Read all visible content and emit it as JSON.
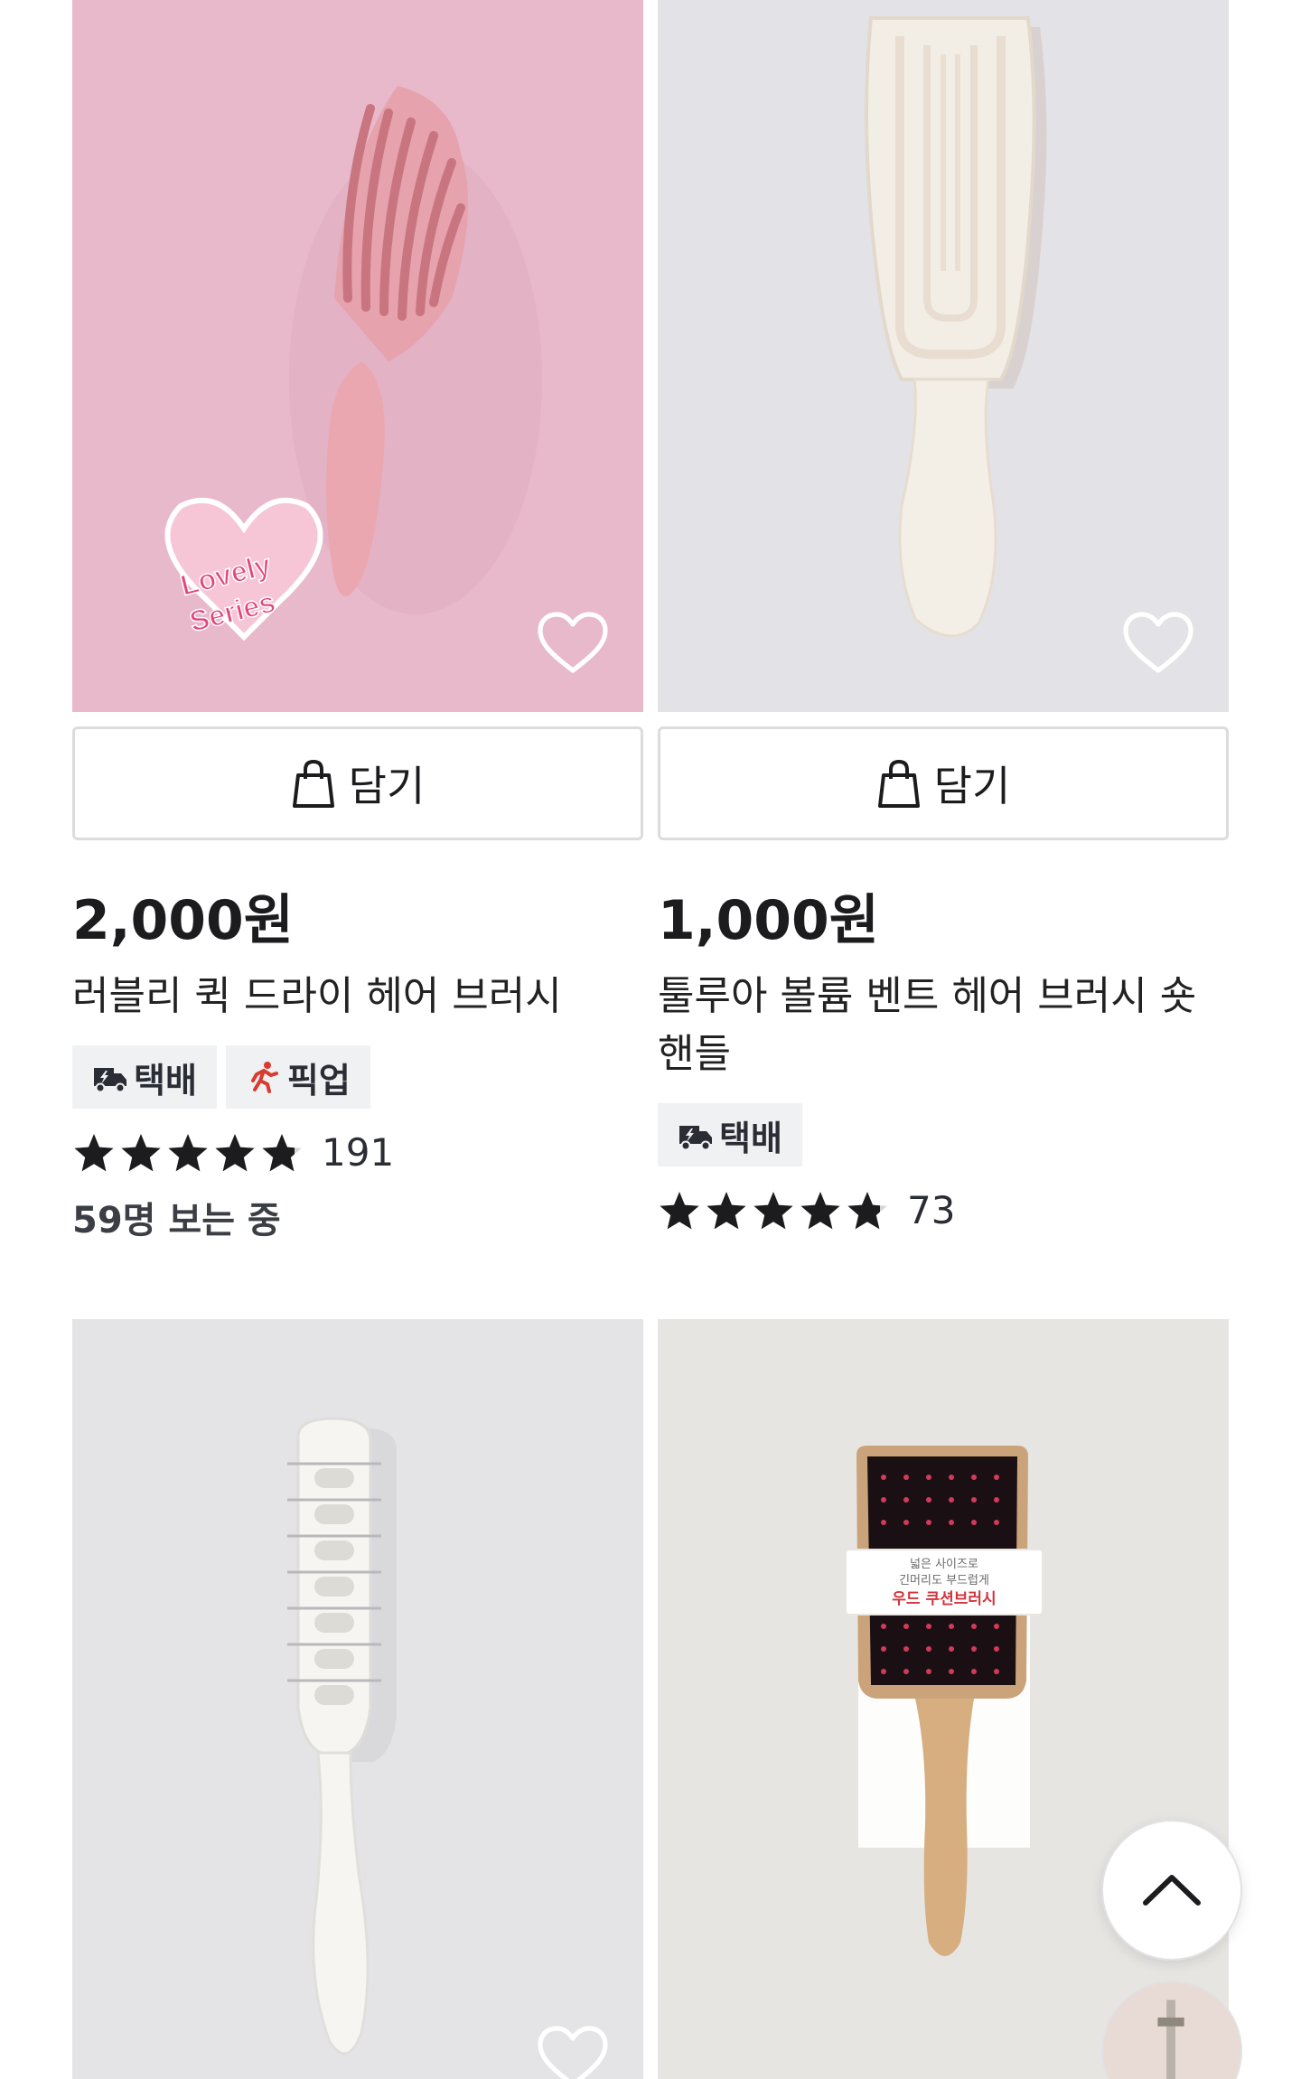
{
  "products": [
    {
      "cart_label": "담기",
      "price": "2,000원",
      "name": "러블리 퀵 드라이 헤어 브러시",
      "tags": [
        {
          "icon": "delivery-truck-icon",
          "label": "택배"
        },
        {
          "icon": "pickup-runner-icon",
          "label": "픽업"
        }
      ],
      "rating": 4.8,
      "review_count": "191",
      "viewers": "59명 보는 중",
      "badge_text": [
        "Lovely",
        "Series"
      ]
    },
    {
      "cart_label": "담기",
      "price": "1,000원",
      "name": "툴루아 볼륨 벤트 헤어 브러시 숏 핸들",
      "tags": [
        {
          "icon": "delivery-truck-icon",
          "label": "택배"
        }
      ],
      "rating": 4.8,
      "review_count": "73"
    },
    {
      "image": "white-vent-brush"
    },
    {
      "image": "wood-cushion-brush",
      "package_text": [
        "넓은 사이즈로",
        "긴머리도 부드럽게",
        "우드 쿠션브러시"
      ]
    }
  ],
  "colors": {
    "pink_bg": "#e8b9cc",
    "gray_bg": "#e4e3e7",
    "accent_red": "#d83b2f",
    "star": "#1c1c1e"
  }
}
